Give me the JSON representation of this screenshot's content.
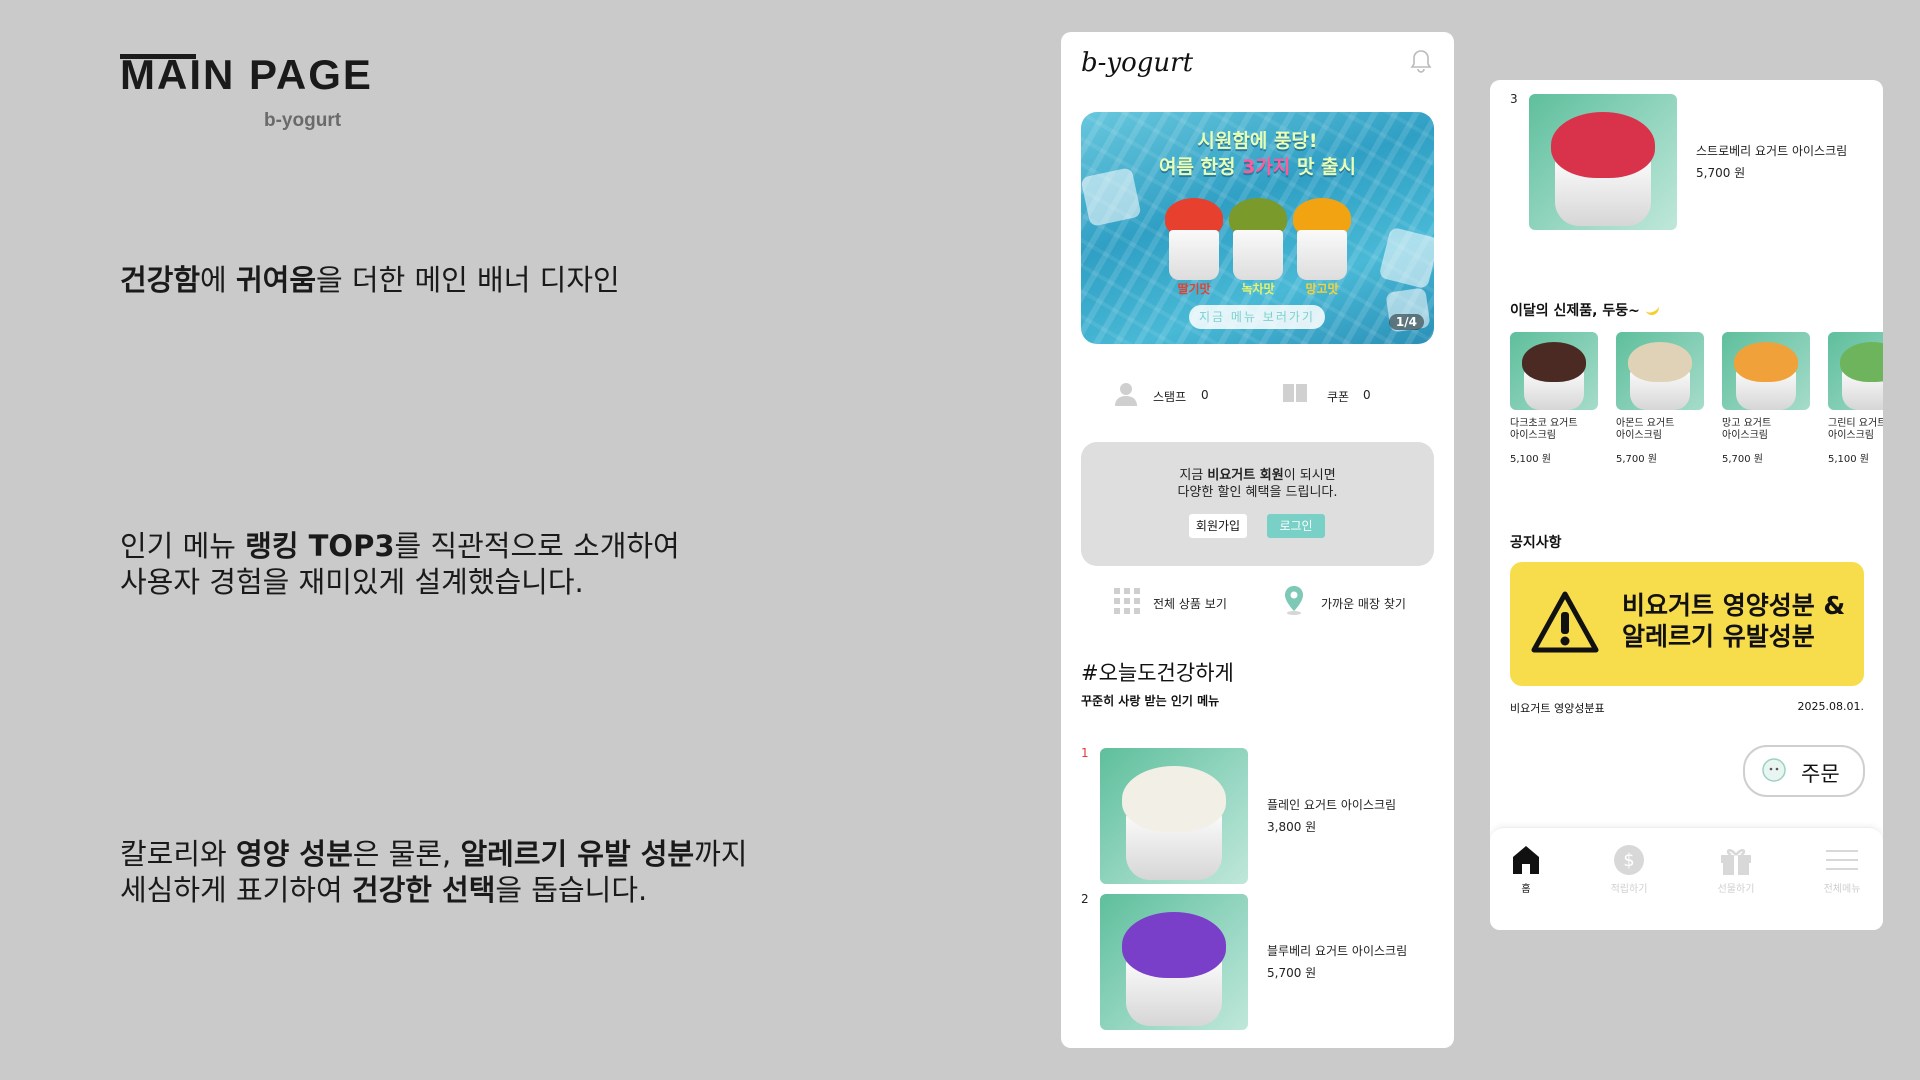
{
  "left": {
    "title": "MAIN PAGE",
    "subtitle": "b-yogurt",
    "desc1": {
      "b1": "건강함",
      "t1": "에 ",
      "b2": "귀여움",
      "t2": "을 더한 메인 배너 디자인"
    },
    "desc2": {
      "t1": "인기 메뉴 ",
      "b1": "랭킹 TOP3",
      "t2": "를 직관적으로 소개하여",
      "line2": "사용자 경험을 재미있게 설계했습니다."
    },
    "desc3": {
      "t1": "칼로리와 ",
      "b1": "영양 성분",
      "t2": "은 물론, ",
      "b2": "알레르기 유발 성분",
      "t3": "까지",
      "line2a": "세심하게 표기하여 ",
      "b3": "건강한 선택",
      "line2b": "을 돕습니다."
    }
  },
  "phone1": {
    "logo": "b-yogurt",
    "banner": {
      "line1": "시원함에 풍당!",
      "line2a": "여름 한정 ",
      "line2hl": "3가지",
      "line2b": " 맛 출시",
      "flavors": [
        "딸기맛",
        "녹차맛",
        "망고맛"
      ],
      "button": "지금 메뉴 보러가기",
      "pager": "1/4"
    },
    "stamp": {
      "label": "스탬프",
      "value": "0"
    },
    "coupon": {
      "label": "쿠폰",
      "value": "0"
    },
    "member": {
      "line1a": "지금 ",
      "line1b": "비요거트 회원",
      "line1c": "이 되시면",
      "line2": "다양한 할인 혜택을 드립니다.",
      "join": "회원가입",
      "login": "로그인"
    },
    "quick": {
      "all": "전체 상품 보기",
      "store": "가까운 매장 찾기"
    },
    "section_title": "#오늘도건강하게",
    "section_sub": "꾸준히 사랑 받는 인기 메뉴",
    "ranking": [
      {
        "rank": "1",
        "name": "플레인 요거트 아이스크림",
        "price": "3,800 원",
        "color": "#f2efe6"
      },
      {
        "rank": "2",
        "name": "블루베리 요거트 아이스크림",
        "price": "5,700 원",
        "color": "#7a3fc9"
      }
    ]
  },
  "phone2": {
    "rank3": {
      "rank": "3",
      "name": "스트로베리 요거트 아이스크림",
      "price": "5,700 원",
      "color": "#d9334b"
    },
    "new_title": "이달의 신제품, 두둥~",
    "new_items": [
      {
        "name1": "다크초코 요거트",
        "name2": "아이스크림",
        "price": "5,100 원",
        "color": "#4a2a22"
      },
      {
        "name1": "아몬드 요거트",
        "name2": "아이스크림",
        "price": "5,700 원",
        "color": "#e0d2b6"
      },
      {
        "name1": "망고 요거트",
        "name2": "아이스크림",
        "price": "5,700 원",
        "color": "#f0a13a"
      },
      {
        "name1": "그린티 요거트",
        "name2": "아이스크림",
        "price": "5,100 원",
        "color": "#6db45c"
      }
    ],
    "notice_title": "공지사항",
    "notice_card": {
      "line1": "비요거트 영양성분 &",
      "line2": "알레르기 유발성분"
    },
    "notice_item": {
      "title": "비요거트 영양성분표",
      "date": "2025.08.01."
    },
    "order_label": "주문",
    "tabs": [
      {
        "label": "홈",
        "icon": "home-icon"
      },
      {
        "label": "적립하기",
        "icon": "dollar-icon"
      },
      {
        "label": "선물하기",
        "icon": "gift-icon"
      },
      {
        "label": "전체메뉴",
        "icon": "menu-icon"
      }
    ]
  }
}
